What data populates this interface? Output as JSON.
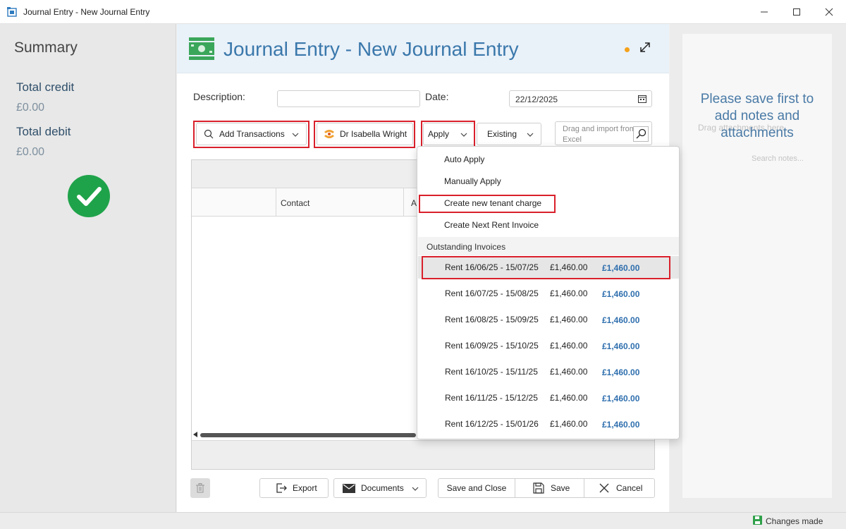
{
  "window": {
    "title": "Journal Entry - New Journal Entry"
  },
  "summary": {
    "title": "Summary",
    "total_credit_label": "Total credit",
    "total_credit_value": "£0.00",
    "total_debit_label": "Total debit",
    "total_debit_value": "£0.00"
  },
  "header": {
    "title": "Journal Entry - New Journal Entry",
    "unsaved_dot_color": "#f5a21a"
  },
  "form": {
    "description_label": "Description:",
    "description_value": "",
    "date_label": "Date:",
    "date_value": "22/12/2025"
  },
  "toolbar": {
    "add_transactions": "Add Transactions",
    "contact": "Dr Isabella Wright",
    "apply": "Apply",
    "existing": "Existing",
    "import_placeholder": "Drag and import from Excel"
  },
  "grid": {
    "columns": [
      "",
      "Contact",
      "A"
    ]
  },
  "dropdown": {
    "items": [
      "Auto Apply",
      "Manually Apply",
      "Create new tenant charge",
      "Create Next Rent Invoice"
    ],
    "section_label": "Outstanding Invoices",
    "invoices": [
      {
        "desc": "Rent 16/06/25 - 15/07/25",
        "amount": "£1,460.00",
        "outstanding": "£1,460.00"
      },
      {
        "desc": "Rent 16/07/25 - 15/08/25",
        "amount": "£1,460.00",
        "outstanding": "£1,460.00"
      },
      {
        "desc": "Rent 16/08/25 - 15/09/25",
        "amount": "£1,460.00",
        "outstanding": "£1,460.00"
      },
      {
        "desc": "Rent 16/09/25 - 15/10/25",
        "amount": "£1,460.00",
        "outstanding": "£1,460.00"
      },
      {
        "desc": "Rent 16/10/25 - 15/11/25",
        "amount": "£1,460.00",
        "outstanding": "£1,460.00"
      },
      {
        "desc": "Rent 16/11/25 - 15/12/25",
        "amount": "£1,460.00",
        "outstanding": "£1,460.00"
      },
      {
        "desc": "Rent 16/12/25 - 15/01/26",
        "amount": "£1,460.00",
        "outstanding": "£1,460.00"
      }
    ]
  },
  "footer": {
    "export": "Export",
    "documents": "Documents",
    "save_close": "Save and Close",
    "save": "Save",
    "cancel": "Cancel"
  },
  "notes": {
    "message": "Please save first to add notes and attachments",
    "drag_placeholder": "Drag attachments here...",
    "search_placeholder": "Search notes..."
  },
  "status": {
    "text": "Changes made"
  },
  "colors": {
    "accent": "#3a78ab",
    "highlight_red": "#d9202b",
    "success_green": "#1fa34a"
  }
}
